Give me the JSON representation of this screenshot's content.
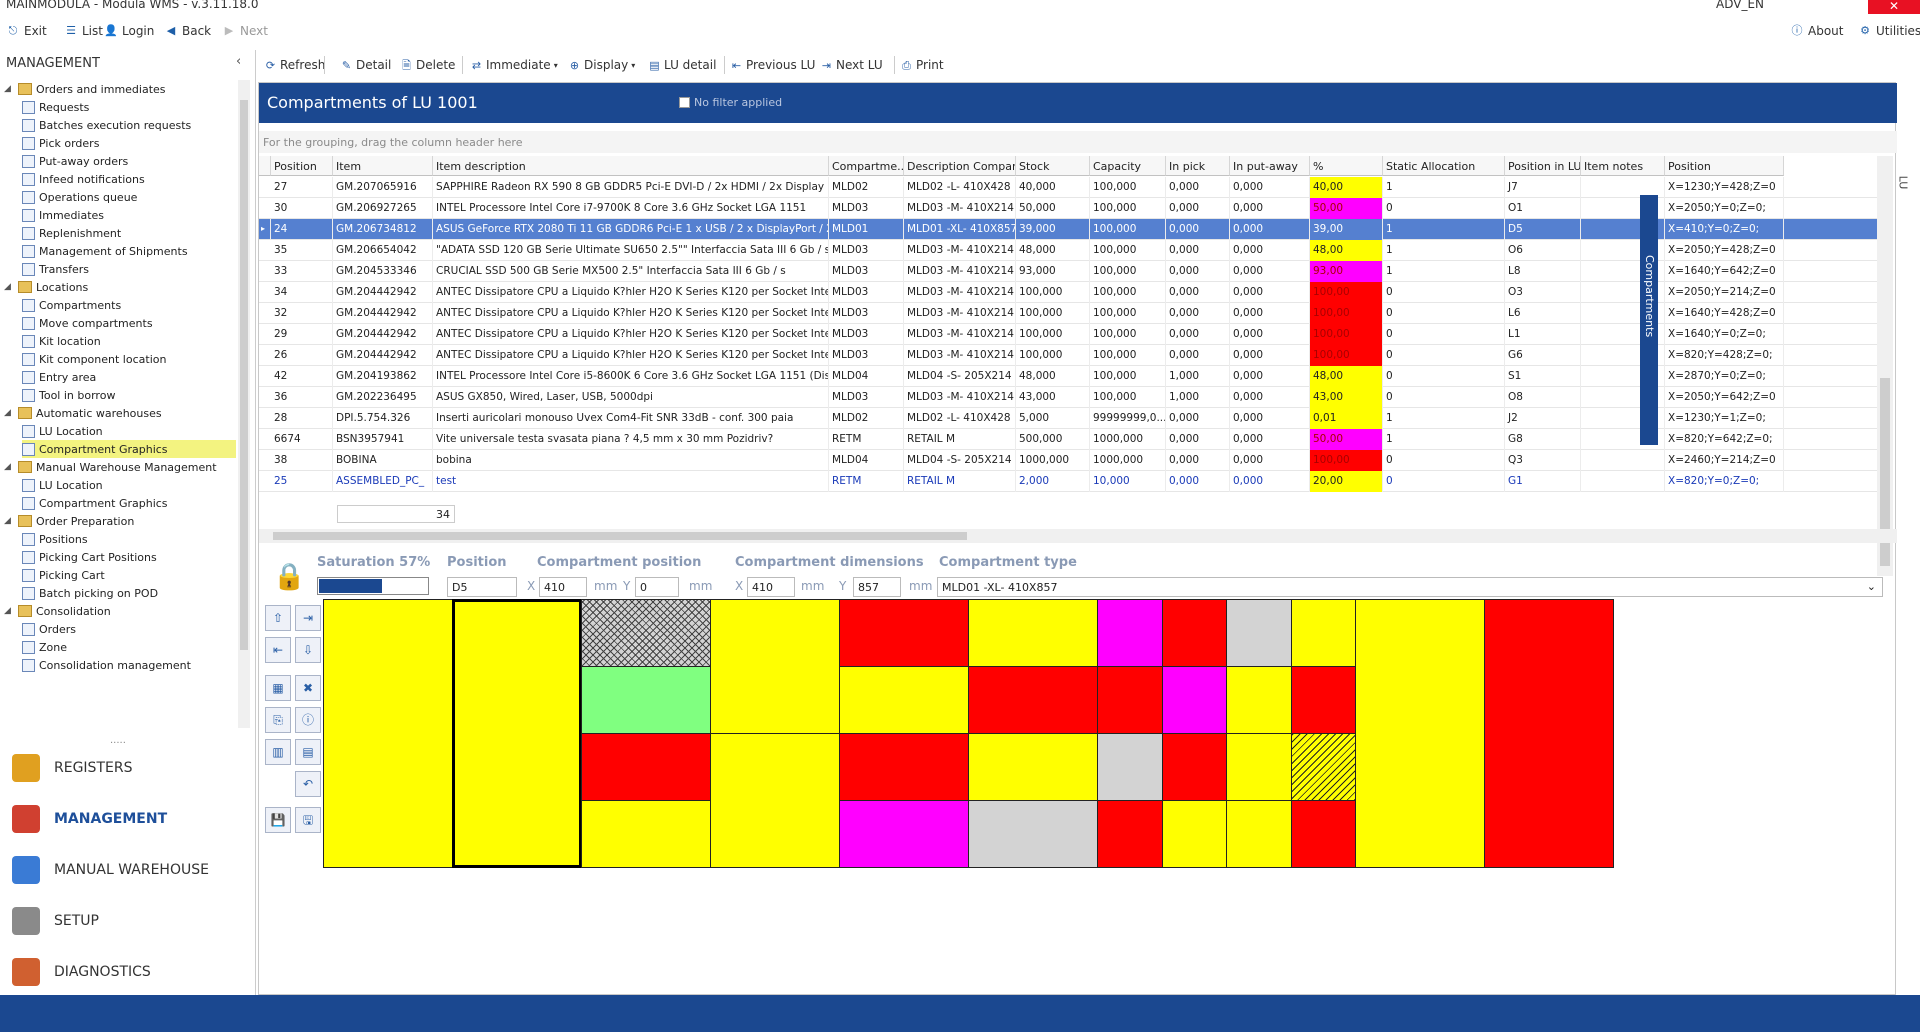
{
  "window": {
    "title": "MAINMODULA - Modula WMS - v.3.11.18.0",
    "user": "ADV_EN"
  },
  "mainbar": {
    "exit": "Exit",
    "list": "List",
    "login": "Login",
    "back": "Back",
    "next": "Next",
    "about": "About",
    "utilities": "Utilities"
  },
  "left": {
    "header": "MANAGEMENT",
    "tree": [
      {
        "label": "Orders and immediates",
        "level": 0,
        "kind": "folder"
      },
      {
        "label": "Requests",
        "level": 1,
        "kind": "leaf"
      },
      {
        "label": "Batches execution requests",
        "level": 1,
        "kind": "leaf"
      },
      {
        "label": "Pick orders",
        "level": 1,
        "kind": "leaf"
      },
      {
        "label": "Put-away orders",
        "level": 1,
        "kind": "leaf"
      },
      {
        "label": "Infeed notifications",
        "level": 1,
        "kind": "leaf"
      },
      {
        "label": "Operations queue",
        "level": 1,
        "kind": "leaf"
      },
      {
        "label": "Immediates",
        "level": 1,
        "kind": "leaf"
      },
      {
        "label": "Replenishment",
        "level": 1,
        "kind": "leaf"
      },
      {
        "label": "Management of Shipments",
        "level": 1,
        "kind": "leaf"
      },
      {
        "label": "Transfers",
        "level": 1,
        "kind": "leaf"
      },
      {
        "label": "Locations",
        "level": 0,
        "kind": "folder"
      },
      {
        "label": "Compartments",
        "level": 1,
        "kind": "leaf"
      },
      {
        "label": "Move compartments",
        "level": 1,
        "kind": "leaf"
      },
      {
        "label": "Kit location",
        "level": 1,
        "kind": "leaf"
      },
      {
        "label": "Kit component location",
        "level": 1,
        "kind": "leaf"
      },
      {
        "label": "Entry area",
        "level": 1,
        "kind": "leaf"
      },
      {
        "label": "Tool in borrow",
        "level": 1,
        "kind": "leaf"
      },
      {
        "label": "Automatic warehouses",
        "level": 0,
        "kind": "folder"
      },
      {
        "label": "LU Location",
        "level": 1,
        "kind": "leaf"
      },
      {
        "label": "Compartment Graphics",
        "level": 1,
        "kind": "leaf",
        "selected": true
      },
      {
        "label": "Manual Warehouse Management",
        "level": 0,
        "kind": "folder"
      },
      {
        "label": "LU Location",
        "level": 1,
        "kind": "leaf"
      },
      {
        "label": "Compartment Graphics",
        "level": 1,
        "kind": "leaf"
      },
      {
        "label": "Order Preparation",
        "level": 0,
        "kind": "folder"
      },
      {
        "label": "Positions",
        "level": 1,
        "kind": "leaf"
      },
      {
        "label": "Picking Cart Positions",
        "level": 1,
        "kind": "leaf"
      },
      {
        "label": "Picking Cart",
        "level": 1,
        "kind": "leaf"
      },
      {
        "label": "Batch picking on POD",
        "level": 1,
        "kind": "leaf"
      },
      {
        "label": "Consolidation",
        "level": 0,
        "kind": "folder"
      },
      {
        "label": "Orders",
        "level": 1,
        "kind": "leaf"
      },
      {
        "label": "Zone",
        "level": 1,
        "kind": "leaf"
      },
      {
        "label": "Consolidation management",
        "level": 1,
        "kind": "leaf"
      }
    ],
    "nav": [
      {
        "label": "REGISTERS",
        "color": "#e0a020"
      },
      {
        "label": "MANAGEMENT",
        "color": "#d04030",
        "active": true
      },
      {
        "label": "MANUAL WAREHOUSE",
        "color": "#3a7bd5"
      },
      {
        "label": "SETUP",
        "color": "#8a8a8a"
      },
      {
        "label": "DIAGNOSTICS",
        "color": "#d06030"
      }
    ]
  },
  "toolbar": {
    "refresh": "Refresh",
    "detail": "Detail",
    "delete": "Delete",
    "immediate": "Immediate",
    "display": "Display",
    "lu_detail": "LU detail",
    "previous_lu": "Previous LU",
    "next_lu": "Next LU",
    "print": "Print"
  },
  "grid": {
    "title": "Compartments of LU 1001",
    "filter_label": "No filter applied",
    "grouping_hint": "For the grouping, drag the column header here",
    "side_tab": "Compartments",
    "lu_tab": "LU",
    "columns": [
      "Position",
      "Item",
      "Item description",
      "Compartme...",
      "Description Compar...",
      "Stock",
      "Capacity",
      "In pick",
      "In put-away",
      "%",
      "Static Allocation",
      "Position in LU",
      "Item notes",
      "Position"
    ],
    "rows": [
      [
        "27",
        "GM.207065916",
        "SAPPHIRE Radeon RX 590 8 GB GDDR5 Pci-E DVI-D / 2x HDMI / 2x Display Port NITRO",
        "MLD02",
        "MLD02 -L- 410X428",
        "40,000",
        "100,000",
        "0,000",
        "0,000",
        "40,00",
        "1",
        "J7",
        "",
        "X=1230;Y=428;Z=0"
      ],
      [
        "30",
        "GM.206927265",
        "INTEL Processore Intel Core i7-9700K 8 Core 3.6 GHz Socket LGA 1151",
        "MLD03",
        "MLD03 -M- 410X214",
        "50,000",
        "100,000",
        "0,000",
        "0,000",
        "50,00",
        "0",
        "O1",
        "",
        "X=2050;Y=0;Z=0;"
      ],
      [
        "24",
        "GM.206734812",
        "ASUS GeForce RTX 2080 Ti 11 GB GDDR6 Pci-E 1 x USB / 2 x DisplayPort / 2 x HDMI",
        "MLD01",
        "MLD01 -XL- 410X857",
        "39,000",
        "100,000",
        "0,000",
        "0,000",
        "39,00",
        "1",
        "D5",
        "",
        "X=410;Y=0;Z=0;"
      ],
      [
        "35",
        "GM.206654042",
        "\"ADATA SSD 120 GB Serie Ultimate SU650 2.5\"\" Interfaccia Sata III 6 Gb / s\"",
        "MLD03",
        "MLD03 -M- 410X214",
        "48,000",
        "100,000",
        "0,000",
        "0,000",
        "48,00",
        "1",
        "O6",
        "",
        "X=2050;Y=428;Z=0"
      ],
      [
        "33",
        "GM.204533346",
        "CRUCIAL SSD 500 GB Serie MX500 2.5\" Interfaccia Sata III 6 Gb / s",
        "MLD03",
        "MLD03 -M- 410X214",
        "93,000",
        "100,000",
        "0,000",
        "0,000",
        "93,00",
        "1",
        "L8",
        "",
        "X=1640;Y=642;Z=0"
      ],
      [
        "34",
        "GM.204442942",
        "ANTEC Dissipatore CPU a Liquido K?hler H2O K Series K120 per Socket Intel",
        "MLD03",
        "MLD03 -M- 410X214",
        "100,000",
        "100,000",
        "0,000",
        "0,000",
        "100,00",
        "0",
        "O3",
        "",
        "X=2050;Y=214;Z=0"
      ],
      [
        "32",
        "GM.204442942",
        "ANTEC Dissipatore CPU a Liquido K?hler H2O K Series K120 per Socket Intel",
        "MLD03",
        "MLD03 -M- 410X214",
        "100,000",
        "100,000",
        "0,000",
        "0,000",
        "100,00",
        "0",
        "L6",
        "",
        "X=1640;Y=428;Z=0"
      ],
      [
        "29",
        "GM.204442942",
        "ANTEC Dissipatore CPU a Liquido K?hler H2O K Series K120 per Socket Intel",
        "MLD03",
        "MLD03 -M- 410X214",
        "100,000",
        "100,000",
        "0,000",
        "0,000",
        "100,00",
        "0",
        "L1",
        "",
        "X=1640;Y=0;Z=0;"
      ],
      [
        "26",
        "GM.204442942",
        "ANTEC Dissipatore CPU a Liquido K?hler H2O K Series K120 per Socket Intel",
        "MLD03",
        "MLD03 -M- 410X214",
        "100,000",
        "100,000",
        "0,000",
        "0,000",
        "100,00",
        "0",
        "G6",
        "",
        "X=820;Y=428;Z=0;"
      ],
      [
        "42",
        "GM.204193862",
        "INTEL Processore Intel Core i5-8600K 6 Core 3.6 GHz Socket LGA 1151 (Dissipatore Escluso)",
        "MLD04",
        "MLD04 -S- 205X214",
        "48,000",
        "100,000",
        "1,000",
        "0,000",
        "48,00",
        "0",
        "S1",
        "",
        "X=2870;Y=0;Z=0;"
      ],
      [
        "36",
        "GM.202236495",
        "ASUS GX850, Wired, Laser, USB, 5000dpi",
        "MLD03",
        "MLD03 -M- 410X214",
        "43,000",
        "100,000",
        "1,000",
        "0,000",
        "43,00",
        "0",
        "O8",
        "",
        "X=2050;Y=642;Z=0"
      ],
      [
        "28",
        "DPI.5.754.326",
        "Inserti auricolari monouso Uvex Com4-Fit SNR 33dB - conf. 300 paia",
        "MLD02",
        "MLD02 -L- 410X428",
        "5,000",
        "99999999,0...",
        "0,000",
        "0,000",
        "0,01",
        "1",
        "J2",
        "",
        "X=1230;Y=1;Z=0;"
      ],
      [
        "6674",
        "BSN3957941",
        "Vite universale testa svasata piana ? 4,5 mm x 30 mm Pozidriv?",
        "RETM",
        "RETAIL M",
        "500,000",
        "1000,000",
        "0,000",
        "0,000",
        "50,00",
        "1",
        "G8",
        "",
        "X=820;Y=642;Z=0;"
      ],
      [
        "38",
        "BOBINA",
        "bobina",
        "MLD04",
        "MLD04 -S- 205X214",
        "1000,000",
        "1000,000",
        "0,000",
        "0,000",
        "100,00",
        "0",
        "Q3",
        "",
        "X=2460;Y=214;Z=0"
      ],
      [
        "25",
        "ASSEMBLED_PC_",
        "test",
        "RETM",
        "RETAIL M",
        "2,000",
        "10,000",
        "0,000",
        "0,000",
        "20,00",
        "0",
        "G1",
        "",
        "X=820;Y=0;Z=0;"
      ]
    ],
    "pct_colors": [
      "#ffff00",
      "#ff00ff",
      "#5580d0",
      "#ffff00",
      "#ff00ff",
      "#ff0000",
      "#ff0000",
      "#ff0000",
      "#ff0000",
      "#ffff00",
      "#ffff00",
      "#ffff00",
      "#ff00ff",
      "#ff0000",
      "#ffff00"
    ],
    "selected_row": 2,
    "blue_row": 14,
    "count": "34"
  },
  "detail": {
    "saturation_label": "Saturation 57%",
    "saturation": 0.57,
    "position_label": "Position",
    "position_value": "D5",
    "comp_pos_label": "Compartment position",
    "x_label": "X",
    "y_label": "Y",
    "mm": "mm",
    "pos_x": "410",
    "pos_y": "0",
    "comp_dim_label": "Compartment dimensions",
    "dim_x": "410",
    "dim_y": "857",
    "comp_type_label": "Compartment type",
    "comp_type_value": "MLD01 -XL-  410X857"
  },
  "colors": {
    "yellow": "#ffff00",
    "red": "#ff0000",
    "magenta": "#ff00ff",
    "green": "#80ff80",
    "gray": "#d3d3d3",
    "brand": "#1b4890"
  }
}
